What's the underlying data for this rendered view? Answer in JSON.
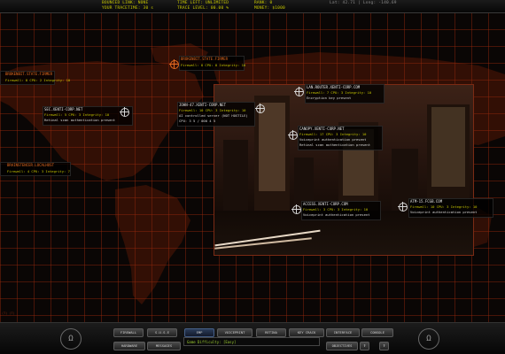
{
  "hud": {
    "bounced_link": "BOUNCED LINK: NONE",
    "trace_speed": "YOUR TRACETIME: 30 s",
    "time_left": "TIME LEFT: UNLIMITED",
    "trace_level": "TRACE LEVEL: 00.00 %",
    "rank": "RANK: 0",
    "money": "MONEY: $1000",
    "lat_long": "Lat: 42.71 | Long: -140.69"
  },
  "nodes": [
    {
      "title": "BROKENBIT.STATE.FIRMER",
      "lines": [
        "Firewall: 8 CPU: 2 Integrity: 10"
      ],
      "color": "orange"
    },
    {
      "title": "BROKENBIT.STATE.FIRMER",
      "lines": [
        "Firewall: 8 CPU: 8 Integrity: 10"
      ],
      "color": "orange"
    },
    {
      "title": "SEC.XENTI-CORP.NET",
      "lines": [
        "Firewall: 5 CPU: 3 Integrity: 10",
        "Retinal scan authentication present"
      ],
      "color": "white"
    },
    {
      "title": "JOHN-47.XENTI-CORP.NET",
      "lines": [
        "Firewall: 10 CPU: 3 Integrity: 10",
        "AI controlled server (NOT HOSTILE)",
        "CPU:    3 5 / 000      4 5"
      ],
      "color": "white"
    },
    {
      "title": "LAN.ROUTER.XENTI-CORP.COM",
      "lines": [
        "Firewall: 7 CPU: 3 Integrity: 10",
        "Encryption key present"
      ],
      "color": "white"
    },
    {
      "title": "CANOPY.XENTI-CORP.NET",
      "lines": [
        "Firewall: 17 CPU: 3 Integrity: 10",
        "Voiceprint authentication present",
        "Retinal scan authentication present"
      ],
      "color": "white"
    },
    {
      "title": "BRAINSTENCER.LOCALHOST",
      "lines": [
        "Firewall: 4 CPU: 3 Integrity: 7"
      ],
      "color": "orange"
    },
    {
      "title": "ACCESS.XENTI-CORP.COM",
      "lines": [
        "Firewall: 3 CPU: 3 Integrity: 10",
        "Voiceprint authentication present"
      ],
      "color": "white"
    },
    {
      "title": "ATM-15.FCGB.COM",
      "lines": [
        "Firewall: 10 CPU: 3 Integrity: 10",
        "Voiceprint authentication present"
      ],
      "color": "white"
    }
  ],
  "toolbar": {
    "row1": [
      "FIREWALL",
      "S.U.S.E",
      "EMP",
      "VOICEPRINT",
      "RETINA",
      "KEY CRACK",
      "INTERFACE",
      "CONSOLE"
    ],
    "row2_left": [
      "HARDWARE",
      "MESSAGES"
    ],
    "objectives": "OBJECTIVES",
    "help": "?",
    "message": "Game Difficulty: [Easy]"
  },
  "side_label": "(T) (T)",
  "colors": {
    "accent": "#e06a20",
    "hud_text": "#c8c800",
    "grid": "#96280a",
    "message": "#9ccc30"
  }
}
